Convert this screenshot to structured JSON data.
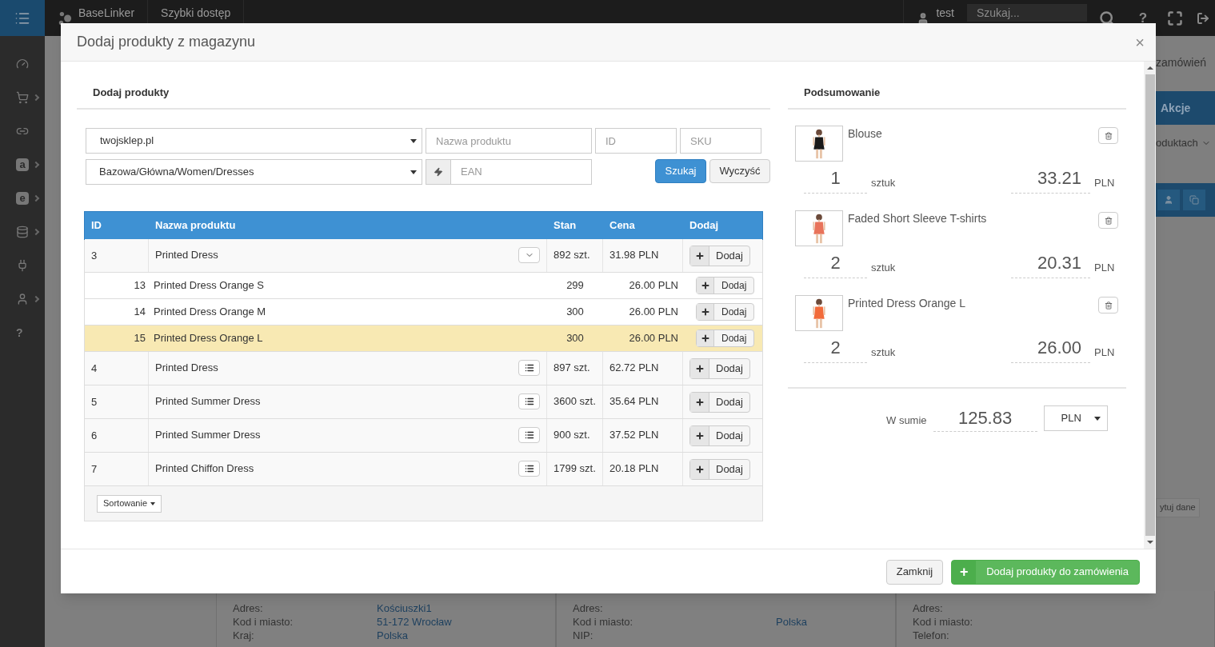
{
  "topbar": {
    "brand": "BaseLinker",
    "quick_access": "Szybki dostęp",
    "user": "test",
    "search": {
      "placeholder": "Szukaj..."
    },
    "help": "?"
  },
  "sidebar": {
    "items": [
      {
        "kind": "gauge",
        "submenu": false
      },
      {
        "kind": "cart",
        "submenu": true
      },
      {
        "kind": "link",
        "submenu": false
      },
      {
        "kind": "letter",
        "label": "a",
        "submenu": true
      },
      {
        "kind": "letter",
        "label": "e",
        "submenu": true
      },
      {
        "kind": "database",
        "submenu": true
      },
      {
        "kind": "plug",
        "submenu": false
      },
      {
        "kind": "user",
        "submenu": true
      },
      {
        "kind": "glyph",
        "label": "?",
        "submenu": false
      }
    ]
  },
  "background": {
    "orders_link": "zamówień",
    "actions_header": "Akcje",
    "products_dropdown": "oduktach",
    "edit_button": "ytuj dane",
    "address_panels": [
      {
        "rows": [
          {
            "label": "Adres:",
            "value": "Kościuszki1"
          },
          {
            "label": "Kod i miasto:",
            "value": "51-172 Wrocław"
          },
          {
            "label": "Kraj:",
            "value": "Polska"
          }
        ]
      },
      {
        "rows": [
          {
            "label": "Adres:"
          },
          {
            "label": "Kod i miasto:",
            "value": "Polska"
          },
          {
            "label": "NIP:"
          }
        ]
      },
      {
        "rows": [
          {
            "label": "Adres:"
          },
          {
            "label": "Kod i miasto:"
          },
          {
            "label": "Telefon:"
          }
        ]
      }
    ]
  },
  "modal": {
    "title": "Dodaj produkty z magazynu",
    "close": "×",
    "add_section": {
      "title": "Dodaj produkty",
      "store_select": "twojsklep.pl",
      "name_field": {
        "placeholder": "Nazwa produktu"
      },
      "id_field": {
        "placeholder": "ID"
      },
      "sku_field": {
        "placeholder": "SKU"
      },
      "category_select": "Bazowa/Główna/Women/Dresses",
      "ean_field": {
        "placeholder": "EAN"
      },
      "search_button": "Szukaj",
      "clear_button": "Wyczyść",
      "table": {
        "columns": [
          "ID",
          "Nazwa produktu",
          "Stan",
          "Cena",
          "Dodaj"
        ],
        "rows": [
          {
            "kind": "product",
            "id": "3",
            "name": "Printed Dress",
            "stock": "892 szt.",
            "price": "31.98 PLN",
            "add": "Dodaj",
            "expanded": true,
            "selected": false,
            "children": [
              {
                "kind": "variant",
                "id": "13",
                "name": "Printed Dress Orange S",
                "stock": "299",
                "price": "26.00 PLN",
                "add": "Dodaj",
                "selected": false
              },
              {
                "kind": "variant",
                "id": "14",
                "name": "Printed Dress Orange M",
                "stock": "300",
                "price": "26.00 PLN",
                "add": "Dodaj",
                "selected": false
              },
              {
                "kind": "variant",
                "id": "15",
                "name": "Printed Dress Orange L",
                "stock": "300",
                "price": "26.00 PLN",
                "add": "Dodaj",
                "selected": true
              }
            ]
          },
          {
            "kind": "product",
            "id": "4",
            "name": "Printed Dress",
            "stock": "897 szt.",
            "price": "62.72 PLN",
            "add": "Dodaj",
            "expanded": false,
            "selected": false
          },
          {
            "kind": "product",
            "id": "5",
            "name": "Printed Summer Dress",
            "stock": "3600 szt.",
            "price": "35.64 PLN",
            "add": "Dodaj",
            "expanded": false,
            "selected": false
          },
          {
            "kind": "product",
            "id": "6",
            "name": "Printed Summer Dress",
            "stock": "900 szt.",
            "price": "37.52 PLN",
            "add": "Dodaj",
            "expanded": false,
            "selected": false
          },
          {
            "kind": "product",
            "id": "7",
            "name": "Printed Chiffon Dress",
            "stock": "1799 szt.",
            "price": "20.18 PLN",
            "add": "Dodaj",
            "expanded": false,
            "selected": false
          }
        ],
        "sort_button": "Sortowanie"
      }
    },
    "summary": {
      "title": "Podsumowanie",
      "items": [
        {
          "name": "Blouse",
          "quantity": "1",
          "unit": "sztuk",
          "price": "33.21",
          "currency": "PLN"
        },
        {
          "name": "Faded Short Sleeve T-shirts",
          "quantity": "2",
          "unit": "sztuk",
          "price": "20.31",
          "currency": "PLN"
        },
        {
          "name": "Printed Dress Orange L",
          "quantity": "2",
          "unit": "sztuk",
          "price": "26.00",
          "currency": "PLN"
        }
      ],
      "total_label": "W sumie",
      "total": "125.83",
      "currency_select": "PLN"
    },
    "footer": {
      "close_button": "Zamknij",
      "submit_button": "Dodaj produkty do zamówienia",
      "submit_icon": "+"
    }
  }
}
